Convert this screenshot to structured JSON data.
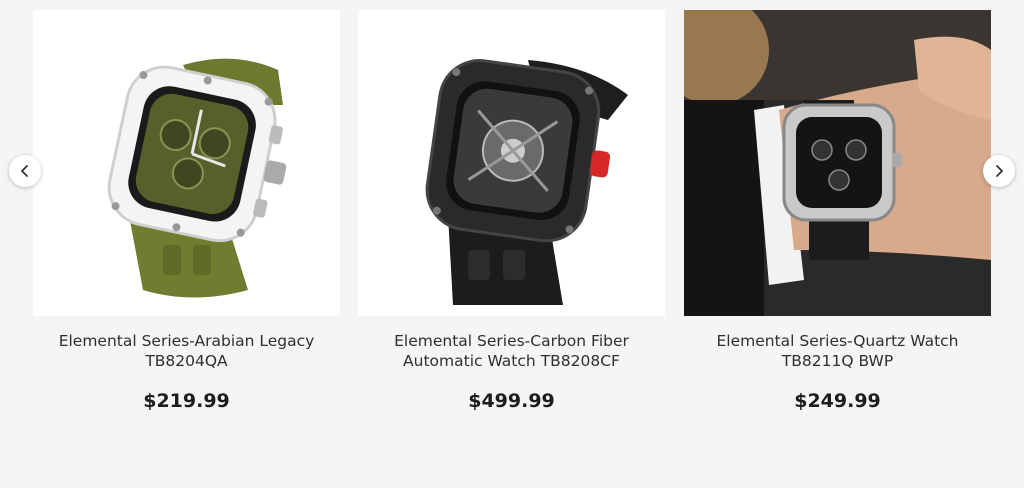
{
  "products": [
    {
      "title": "Elemental Series-Arabian Legacy TB8204QA",
      "price": "$219.99",
      "image": "watch-green-white"
    },
    {
      "title": "Elemental Series-Carbon Fiber Automatic Watch TB8208CF",
      "price": "$499.99",
      "image": "watch-carbon-black"
    },
    {
      "title": "Elemental Series-Quartz Watch TB8211Q BWP",
      "price": "$249.99",
      "image": "watch-on-wrist"
    }
  ],
  "nav": {
    "prev_icon": "chevron-left-icon",
    "next_icon": "chevron-right-icon"
  }
}
